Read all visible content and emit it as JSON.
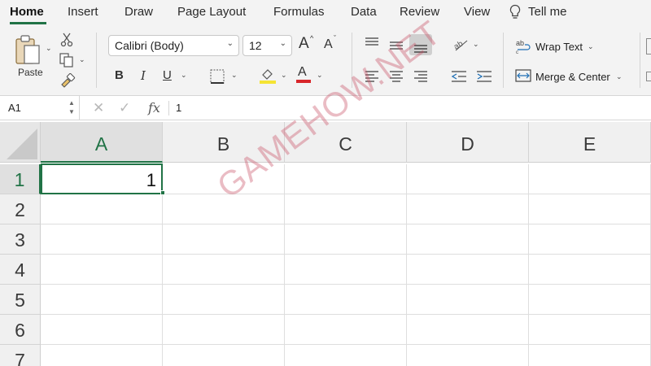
{
  "tabs": [
    {
      "label": "Home",
      "active": true
    },
    {
      "label": "Insert"
    },
    {
      "label": "Draw"
    },
    {
      "label": "Page Layout"
    },
    {
      "label": "Formulas"
    },
    {
      "label": "Data"
    },
    {
      "label": "Review"
    },
    {
      "label": "View"
    },
    {
      "label": "Tell me",
      "icon": "lightbulb-icon"
    }
  ],
  "ribbon": {
    "paste_label": "Paste",
    "font_name": "Calibri (Body)",
    "font_size": "12",
    "bold": "B",
    "italic": "I",
    "underline": "U",
    "grow_font": "A",
    "shrink_font": "A",
    "font_color_letter": "A",
    "wrap_text": "Wrap Text",
    "merge_center": "Merge & Center",
    "highlight_color": "#f5e433",
    "font_color": "#d8262a"
  },
  "formula_bar": {
    "name_box": "A1",
    "cancel_icon": "✕",
    "enter_icon": "✓",
    "fx": "fx",
    "value": "1"
  },
  "grid": {
    "columns": [
      "A",
      "B",
      "C",
      "D",
      "E"
    ],
    "rows": [
      "1",
      "2",
      "3",
      "4",
      "5",
      "6",
      "7"
    ],
    "selected_column": "A",
    "selected_row": "1",
    "cells": {
      "A1": "1"
    }
  },
  "watermark": "GAMEHOW.NET",
  "colors": {
    "accent": "#217346",
    "ribbon_bg": "#f3f3f3"
  }
}
